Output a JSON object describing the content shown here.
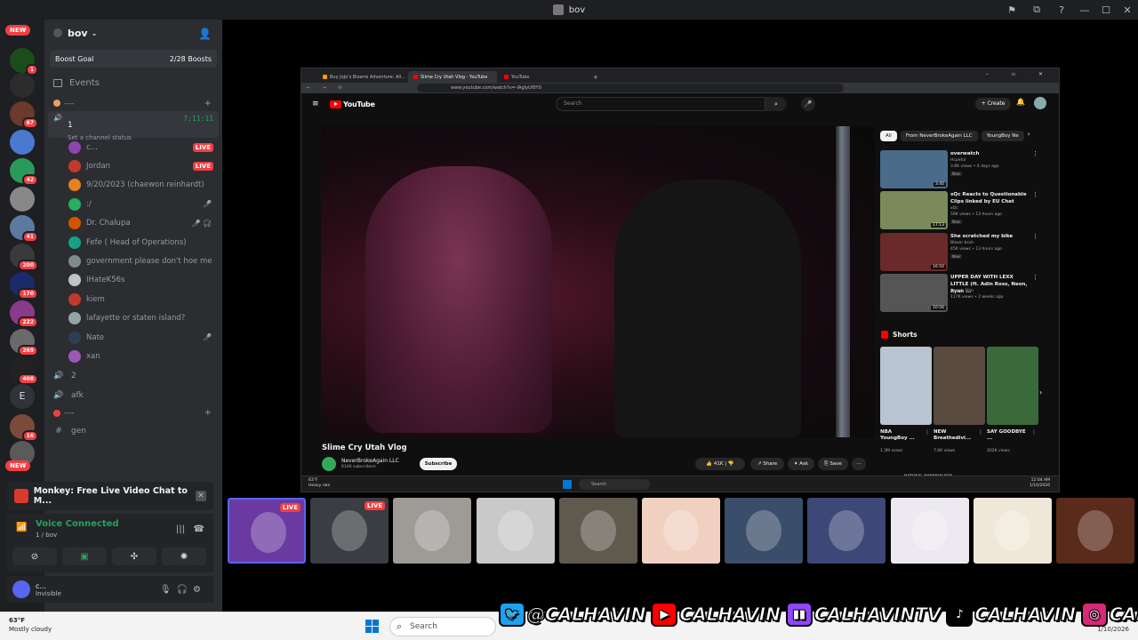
{
  "window": {
    "title": "bov",
    "controls": [
      "—",
      "☐",
      "✕"
    ],
    "top_icons": [
      "⚑",
      "⧉",
      "?"
    ]
  },
  "rail": {
    "new_top": "NEW",
    "new_bottom": "NEW",
    "letter_server": "E",
    "badges": [
      "1",
      "67",
      "42",
      "41",
      "200",
      "170",
      "222",
      "269",
      "408",
      "16"
    ]
  },
  "sidebar": {
    "server_name": "bov",
    "boost_label": "Boost Goal",
    "boost_value": "2/28 Boosts",
    "events": "Events",
    "category1": "----",
    "voice_channel": {
      "name": "1",
      "time": "7:11:11",
      "status": "Set a channel status"
    },
    "members": [
      {
        "name": "c...",
        "live": "LIVE",
        "color": "#8e44ad"
      },
      {
        "name": "Jordan",
        "live": "LIVE",
        "color": "#c0392b"
      },
      {
        "name": "9/20/2023 (chaewon reinhardt)",
        "color": "#e67e22"
      },
      {
        "name": ":/",
        "mute": "🎤̸",
        "color": "#27ae60"
      },
      {
        "name": "Dr. Chalupa",
        "mute": "🎤̸ 🎧̸",
        "color": "#d35400"
      },
      {
        "name": "Fefe ( Head of Operations)",
        "color": "#16a085"
      },
      {
        "name": "government please don't hoe me",
        "color": "#7f8c8d"
      },
      {
        "name": "IHateK56s",
        "color": "#bdc3c7"
      },
      {
        "name": "kiem",
        "color": "#c0392b"
      },
      {
        "name": "lafayette or staten island?",
        "color": "#95a5a6"
      },
      {
        "name": "Nate",
        "mute": "🎤̸",
        "color": "#2c3e50"
      },
      {
        "name": "xan",
        "color": "#9b59b6"
      }
    ],
    "channels": [
      {
        "icon": "🔊",
        "name": "2"
      },
      {
        "icon": "🔊",
        "name": "afk"
      }
    ],
    "category2": "----",
    "text_channel": "gen"
  },
  "notice": {
    "text": "Monkey: Free Live Video Chat to M..."
  },
  "voice": {
    "status": "Voice Connected",
    "location": "1 / bov"
  },
  "user": {
    "name": "c...",
    "status": "Invisible"
  },
  "browser": {
    "tabs": [
      {
        "label": "Buy JoJo's Bizarre Adventure: All..."
      },
      {
        "label": "Slime Cry Utah Vlog - YouTube"
      },
      {
        "label": "YouTube"
      }
    ],
    "url": "www.youtube.com/watch?v=-IAgIyUf0Y0"
  },
  "youtube": {
    "logo": "YouTube",
    "search_placeholder": "Search",
    "create": "Create",
    "video_title": "Slime Cry Utah Vlog",
    "channel": "NeverBrokeAgain LLC",
    "subscribers": "614K subscribers",
    "subscribe": "Subscribe",
    "likes": "41K",
    "share": "Share",
    "ask": "Ask",
    "save": "Save",
    "chips": [
      "All",
      "From NeverBrokeAgain LLC",
      "YoungBoy Ne"
    ],
    "recommendations": [
      {
        "title": "overwatch",
        "channel": "Hcpeful",
        "meta": "3.6K views • 4 days ago",
        "badge": "New",
        "duration": "3:40",
        "color": "#4a6b8a"
      },
      {
        "title": "xQc Reacts to Questionable Clips linked by EU Chat",
        "channel": "xQc",
        "meta": "50K views • 13 hours ago",
        "badge": "New",
        "duration": "17:13",
        "color": "#7a8a5a"
      },
      {
        "title": "She scratched my bike",
        "channel": "Blaxer bruh",
        "meta": "45K views • 13 hours ago",
        "badge": "New",
        "duration": "16:50",
        "color": "#6a2a2a"
      },
      {
        "title": "UPPER DAY WITH LEXX LITTLE (ft. Adin Ross, Neon, Ryan ...",
        "channel": "Joseph Shin",
        "meta": "117K views • 2 weeks ago",
        "duration": "10:56",
        "color": "#555"
      }
    ],
    "shorts_label": "Shorts",
    "shorts": [
      {
        "title": "NBA YoungBoy ...",
        "views": "1.3M views",
        "color": "#b8c4d0"
      },
      {
        "title": "NEW Breathedivi...",
        "views": "7.6K views",
        "color": "#5a4a40"
      },
      {
        "title": "SAY GOODBYE ...",
        "views": "202K views",
        "color": "#3a6a3a"
      }
    ],
    "next_short": "NATURAL BODYBUILDER"
  },
  "mini_taskbar": {
    "weather": "63°F",
    "weather_desc": "Heavy rain",
    "search": "Search",
    "time": "12:04 AM",
    "date": "1/10/2026"
  },
  "tiles": [
    {
      "live": "LIVE",
      "color": "#6a3aa0"
    },
    {
      "live": "LIVE",
      "color": "#3a3d42"
    },
    {
      "color": "#9e9a96"
    },
    {
      "color": "#c9c9c9"
    },
    {
      "color": "#5f5a4e"
    },
    {
      "color": "#f0d0c0"
    },
    {
      "color": "#3a4d6a"
    },
    {
      "color": "#3d4878"
    },
    {
      "color": "#eceaf0"
    },
    {
      "color": "#efe7d8"
    },
    {
      "color": "#5a2a1a"
    }
  ],
  "taskbar": {
    "temp": "63°F",
    "weather": "Mostly cloudy",
    "search": "Search",
    "date": "1/10/2026"
  },
  "overlay": {
    "twitter": "@CALHAVIN",
    "youtube": "CALHAVIN",
    "twitch": "CALHAVINTV",
    "tiktok": "CALHAVIN",
    "instagram": "CAL.HAVIN"
  }
}
